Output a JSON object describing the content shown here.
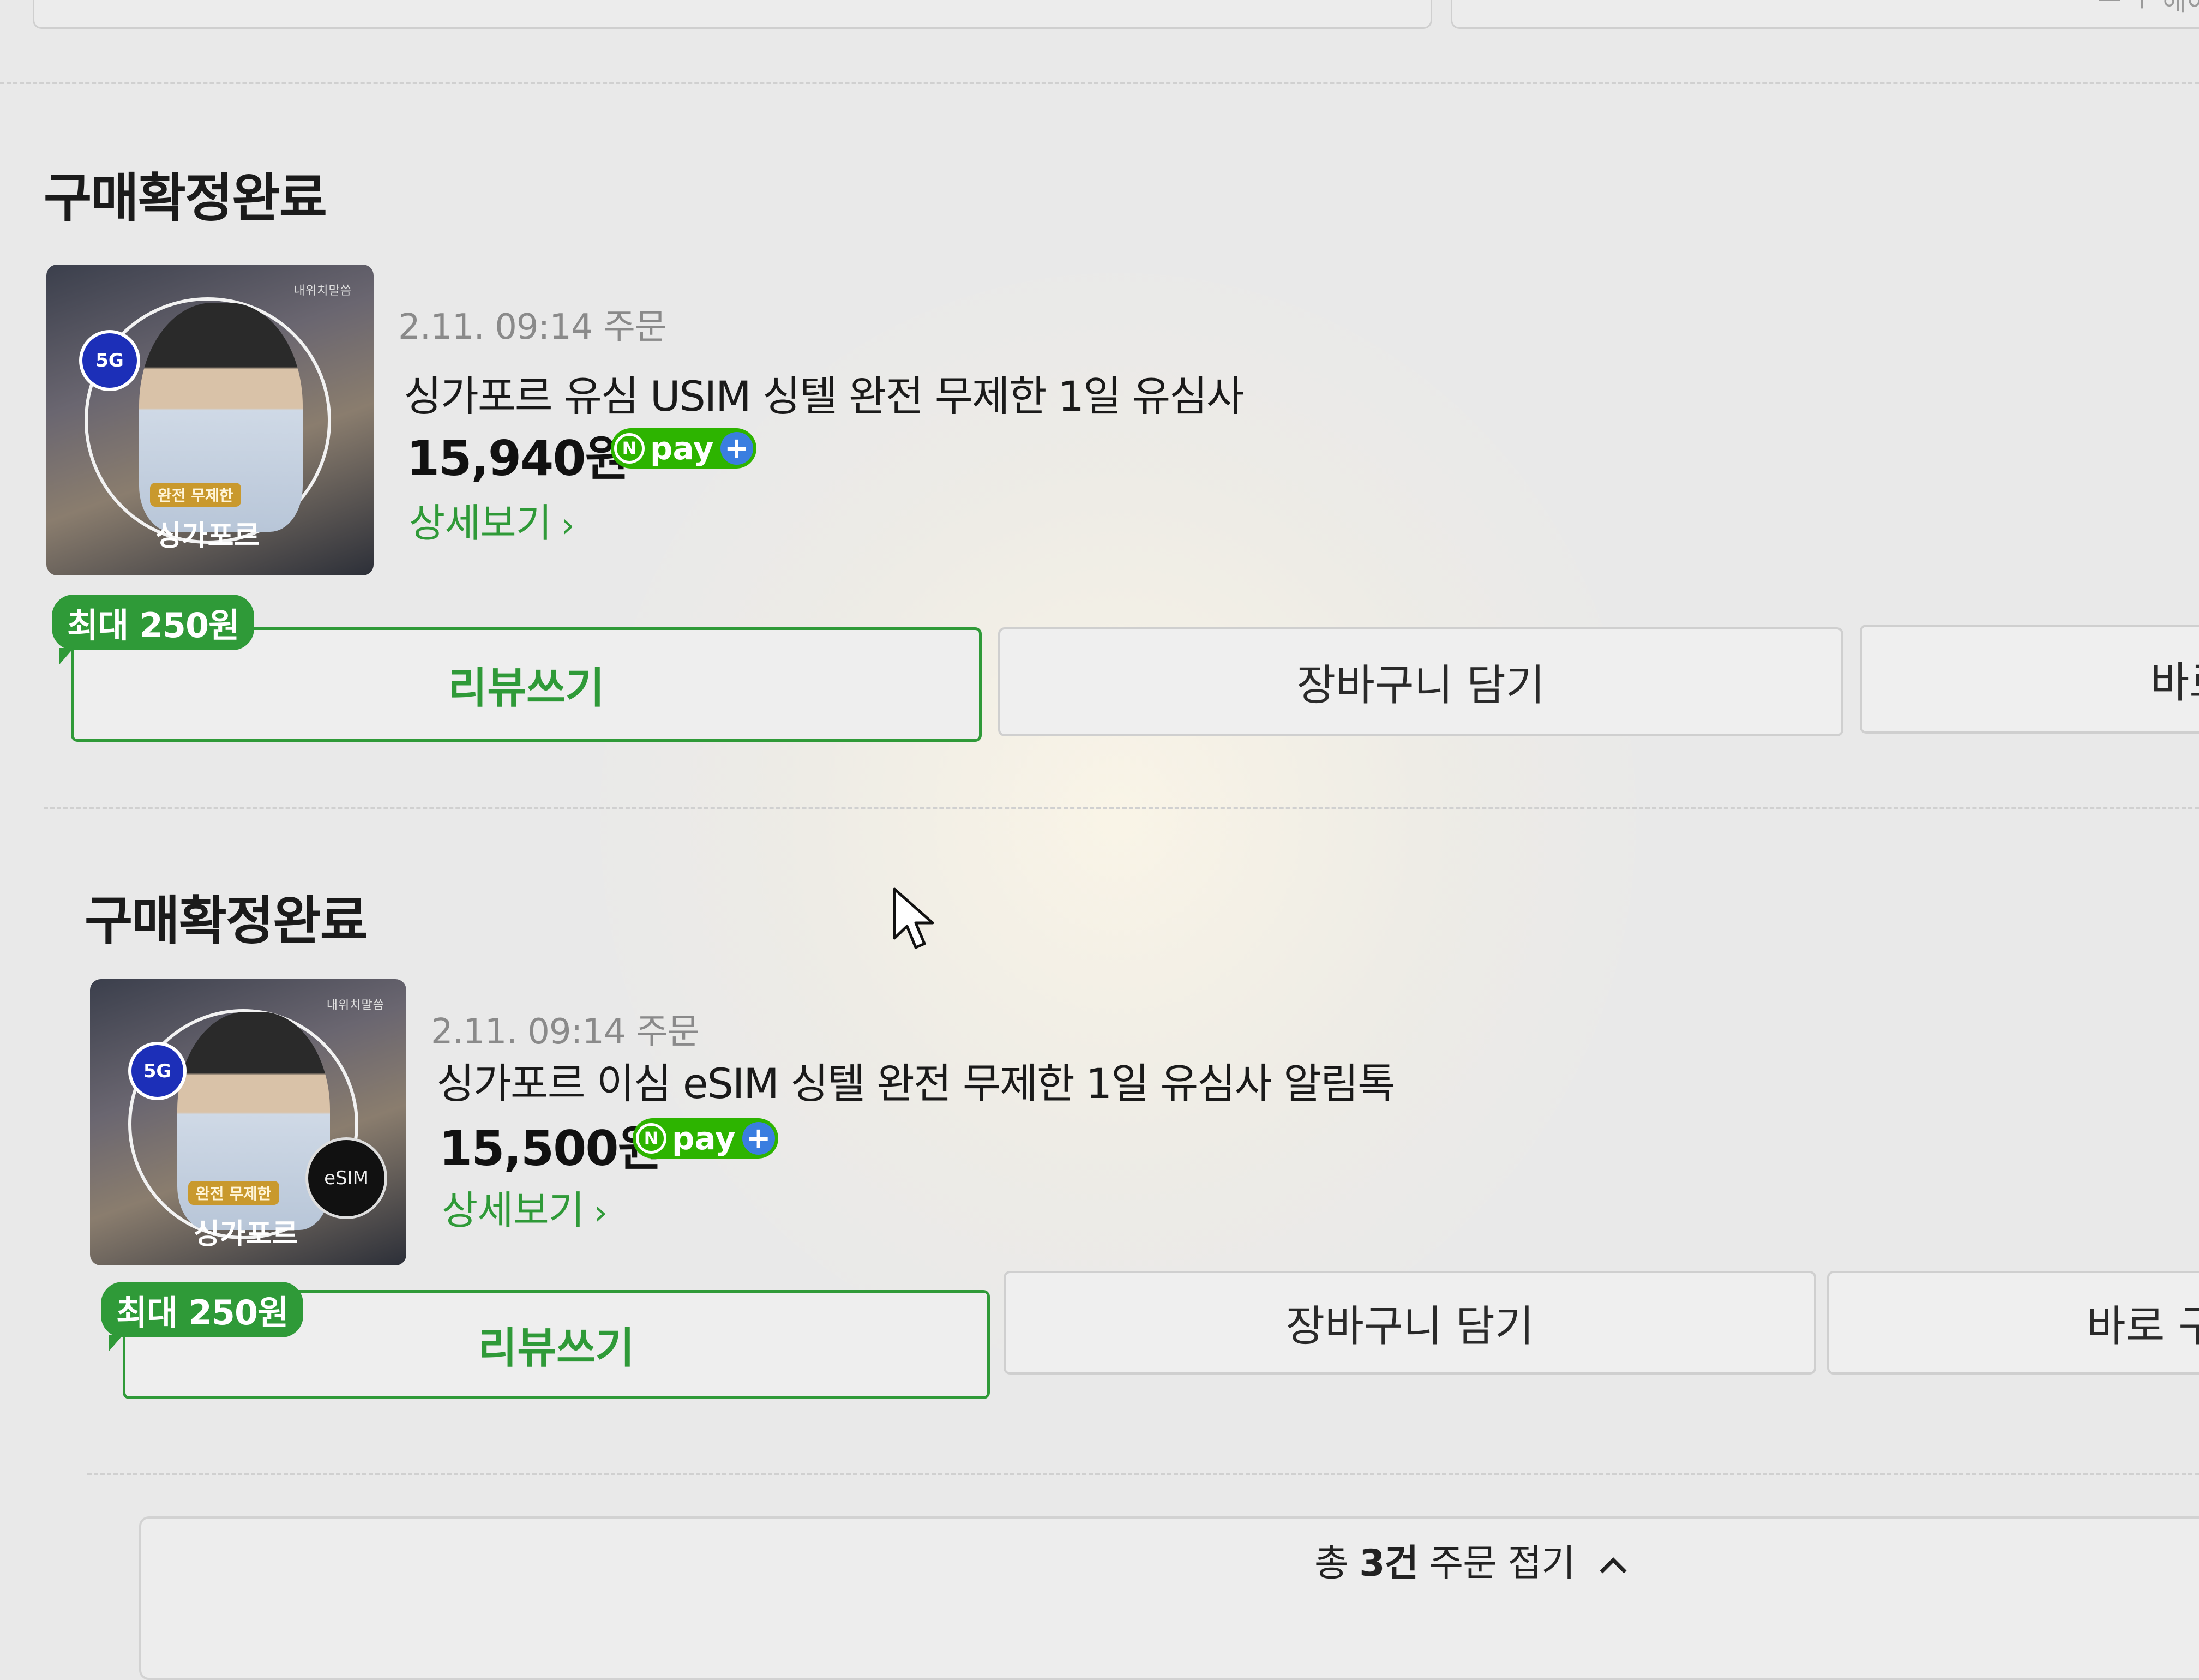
{
  "header": {
    "partial_text": "ㅡ ㅜ 헤이"
  },
  "orders": [
    {
      "status": "구매확정완료",
      "thumbnail": {
        "brand": "내위치말씀",
        "network_badge": "5G",
        "tag": "완전 무제한",
        "place": "싱가포르",
        "esim_badge": ""
      },
      "date": "2.11. 09:14 주문",
      "title": "싱가포르 유심 USIM 싱텔 완전 무제한 1일 유심사",
      "price": "15,940원",
      "pay_badge": {
        "n": "N",
        "text": "pay",
        "plus": "+"
      },
      "detail_label": "상세보기",
      "reward_badge": "최대 250원",
      "review_button": "리뷰쓰기",
      "cart_button": "장바구니 담기",
      "buy_button": "바로"
    },
    {
      "status": "구매확정완료",
      "thumbnail": {
        "brand": "내위치말씀",
        "network_badge": "5G",
        "tag": "완전 무제한",
        "place": "싱가포르",
        "esim_badge": "eSIM"
      },
      "date": "2.11. 09:14 주문",
      "title": "싱가포르 이심 eSIM 싱텔 완전 무제한 1일 유심사 알림톡",
      "price": "15,500원",
      "pay_badge": {
        "n": "N",
        "text": "pay",
        "plus": "+"
      },
      "detail_label": "상세보기",
      "reward_badge": "최대 250원",
      "review_button": "리뷰쓰기",
      "cart_button": "장바구니 담기",
      "buy_button": "바로 구"
    }
  ],
  "fold": {
    "prefix": "총 ",
    "count": "3건",
    "suffix": " 주문 접기"
  },
  "colors": {
    "accent_green": "#2f9a38",
    "npay_green": "#2db400",
    "badge_blue": "#1c2fb8"
  }
}
